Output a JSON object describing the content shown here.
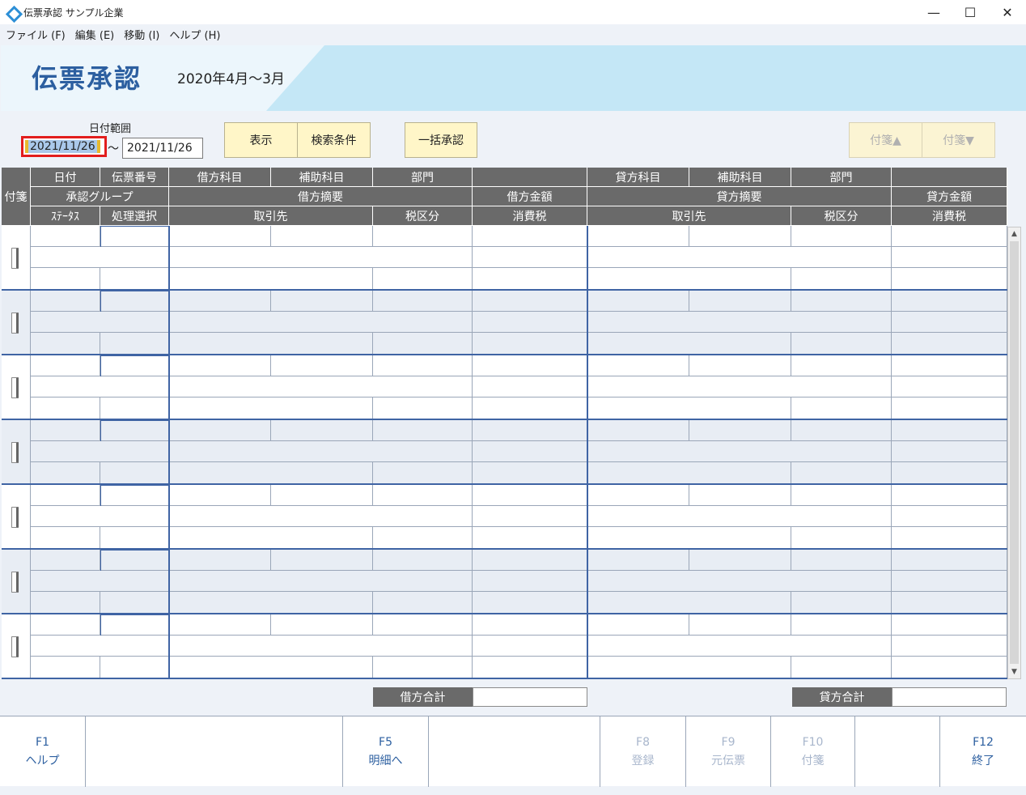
{
  "window": {
    "title": "伝票承認 サンプル企業",
    "minimize": "—",
    "maximize": "☐",
    "close": "✕"
  },
  "menu": [
    "ファイル (F)",
    "編集 (E)",
    "移動 (I)",
    "ヘルプ (H)"
  ],
  "banner": {
    "title": "伝票承認",
    "period": "2020年4月～3月"
  },
  "filter": {
    "range_label": "日付範囲",
    "date_from": "2021/11/26",
    "tilde": "～",
    "date_to": "2021/11/26"
  },
  "buttons": {
    "show": "表示",
    "search": "検索条件",
    "bulk": "一括承認",
    "tag_up": "付箋▲",
    "tag_down": "付箋▼"
  },
  "headers": {
    "tag": "付箋",
    "date": "日付",
    "voucher_no": "伝票番号",
    "debit_account": "借方科目",
    "debit_sub": "補助科目",
    "debit_dept": "部門",
    "credit_account": "貸方科目",
    "credit_sub": "補助科目",
    "credit_dept": "部門",
    "approval_group": "承認グループ",
    "debit_desc": "借方摘要",
    "debit_amount": "借方金額",
    "credit_desc": "貸方摘要",
    "credit_amount": "貸方金額",
    "status": "ｽﾃｰﾀｽ",
    "process": "処理選択",
    "debit_partner": "取引先",
    "debit_tax": "税区分",
    "debit_ctax": "消費税",
    "credit_partner": "取引先",
    "credit_tax": "税区分",
    "credit_ctax": "消費税"
  },
  "totals": {
    "debit_label": "借方合計",
    "credit_label": "貸方合計"
  },
  "fkeys": [
    {
      "key": "F1",
      "label": "ヘルプ"
    },
    {
      "key": "F5",
      "label": "明細へ"
    },
    {
      "key": "F8",
      "label": "登録"
    },
    {
      "key": "F9",
      "label": "元伝票"
    },
    {
      "key": "F10",
      "label": "付箋"
    },
    {
      "key": "F12",
      "label": "終了"
    }
  ]
}
